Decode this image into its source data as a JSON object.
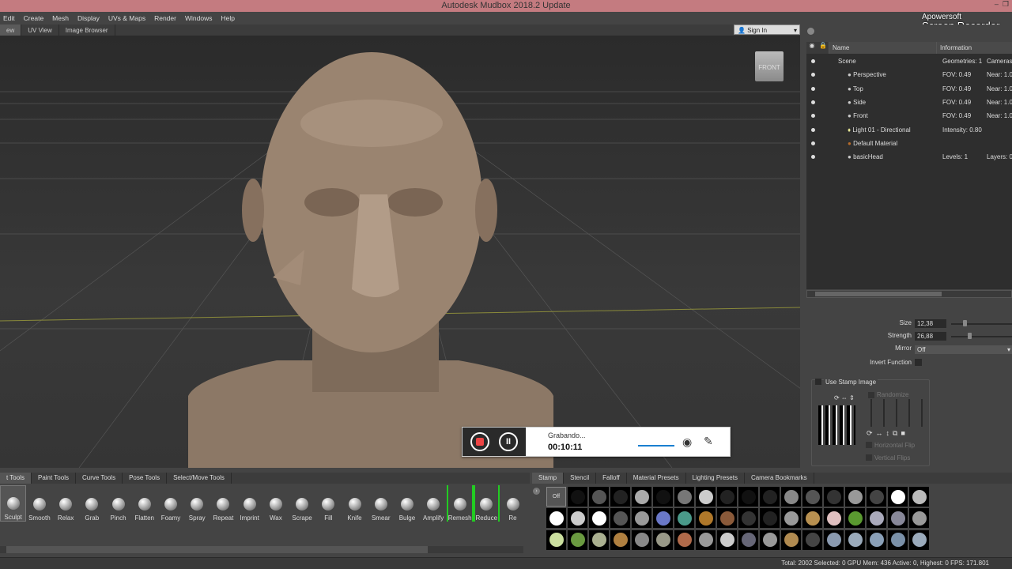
{
  "title": "Autodesk Mudbox 2018.2 Update",
  "menu": [
    "Edit",
    "Create",
    "Mesh",
    "Display",
    "UVs & Maps",
    "Render",
    "Windows",
    "Help"
  ],
  "view_tabs": [
    "ew",
    "UV View",
    "Image Browser"
  ],
  "sign_in": "Sign In",
  "viewcube_label": "FRONT",
  "watermark": {
    "line1": "Apowersoft",
    "line2": "Screen Recorder"
  },
  "outliner": {
    "headers": [
      "Name",
      "Information"
    ],
    "rows": [
      {
        "name": "Scene",
        "info1": "Geometries: 1",
        "info2": "Cameras",
        "indent": 0
      },
      {
        "name": "Perspective",
        "info1": "FOV: 0.49",
        "info2": "Near: 1.0",
        "indent": 1,
        "icon": "camera-icon"
      },
      {
        "name": "Top",
        "info1": "FOV: 0.49",
        "info2": "Near: 1.0",
        "indent": 1,
        "icon": "camera-icon"
      },
      {
        "name": "Side",
        "info1": "FOV: 0.49",
        "info2": "Near: 1.0",
        "indent": 1,
        "icon": "camera-icon"
      },
      {
        "name": "Front",
        "info1": "FOV: 0.49",
        "info2": "Near: 1.0",
        "indent": 1,
        "icon": "camera-icon"
      },
      {
        "name": "Light 01 - Directional",
        "info1": "Intensity: 0.80",
        "info2": "",
        "indent": 1,
        "icon": "light-icon"
      },
      {
        "name": "Default Material",
        "info1": "",
        "info2": "",
        "indent": 1,
        "icon": "material-icon"
      },
      {
        "name": "basicHead",
        "info1": "Levels: 1",
        "info2": "Layers: 0",
        "indent": 1,
        "icon": "mesh-icon"
      }
    ]
  },
  "properties": {
    "size_label": "Size",
    "size_value": "12,38",
    "size_fraction": 0.2,
    "strength_label": "Strength",
    "strength_value": "26,88",
    "strength_fraction": 0.27,
    "mirror_label": "Mirror",
    "mirror_value": "Off",
    "invert_label": "Invert Function",
    "use_stamp_label": "Use Stamp Image",
    "randomize_label": "Randomize",
    "hflip_label": "Horizontal Flip",
    "vflip_label": "Vertical Flips"
  },
  "tool_tabs": [
    "t Tools",
    "Paint Tools",
    "Curve Tools",
    "Pose Tools",
    "Select/Move Tools"
  ],
  "tools": [
    "Sculpt",
    "Smooth",
    "Relax",
    "Grab",
    "Pinch",
    "Flatten",
    "Foamy",
    "Spray",
    "Repeat",
    "Imprint",
    "Wax",
    "Scrape",
    "Fill",
    "Knife",
    "Smear",
    "Bulge",
    "Amplify",
    "Remesh",
    "Reduce",
    "Re"
  ],
  "stamp_tabs": [
    "Stamp",
    "Stencil",
    "Falloff",
    "Material Presets",
    "Lighting Presets",
    "Camera Bookmarks"
  ],
  "stamp_off": "Off",
  "stamp_colors": [
    "#111",
    "#555",
    "#222",
    "#aaa",
    "#111",
    "#777",
    "#ccc",
    "#222",
    "#111",
    "#222",
    "#888",
    "#555",
    "#333",
    "#999",
    "#444",
    "#fff",
    "#bbb",
    "#fff",
    "#ccc",
    "#fff",
    "#555",
    "#999",
    "#6a78c8",
    "#4a9a8a",
    "#b0782a",
    "#8a5a3a",
    "#333",
    "#222",
    "#999",
    "#b89050",
    "#e0c0c0",
    "#5a9a30",
    "#aab",
    "#889",
    "#999",
    "#cce0a0",
    "#6a9a40",
    "#aab090",
    "#b08040",
    "#888",
    "#998",
    "#b06a4a",
    "#999",
    "#ccc",
    "#667",
    "#999",
    "#b08a50",
    "#444",
    "#8a9ab0",
    "#9aaabb",
    "#8aa0b8",
    "#7a90a8",
    "#9aaabb"
  ],
  "recorder": {
    "status": "Grabando...",
    "time": "00:10:11"
  },
  "status_bar": "Total: 2002  Selected: 0 GPU Mem: 436  Active: 0, Highest: 0  FPS: 171.801"
}
